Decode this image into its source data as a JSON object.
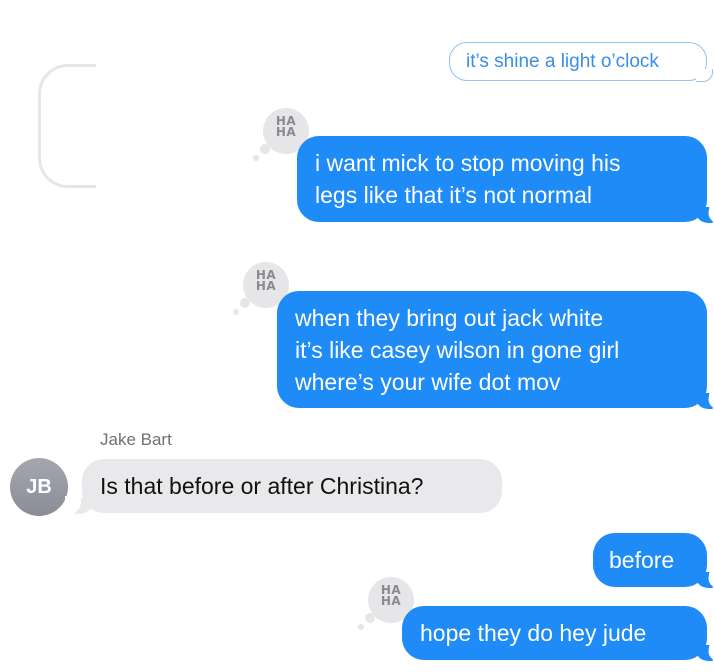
{
  "messages": {
    "m1": {
      "text": "it’s shine a light o’clock"
    },
    "m2": {
      "line1": "i want mick to stop moving his",
      "line2": "legs like that it’s not normal",
      "reaction": "HA HA"
    },
    "m3": {
      "line1": "when they bring out jack white",
      "line2": "it’s like casey wilson in gone girl",
      "line3": "where’s your wife dot mov",
      "reaction": "HA HA"
    },
    "m4": {
      "sender": "Jake Bart",
      "avatar_initials": "JB",
      "text": "Is that before or after Christina?"
    },
    "m5": {
      "text": "before"
    },
    "m6": {
      "text": "hope they do hey jude",
      "reaction": "HA HA"
    }
  },
  "colors": {
    "sent_bubble": "#1e8bf7",
    "received_bubble": "#e9e9eb",
    "tapback": "#e6e6e8"
  },
  "icons": {
    "tapback": "haha-reaction-icon"
  }
}
